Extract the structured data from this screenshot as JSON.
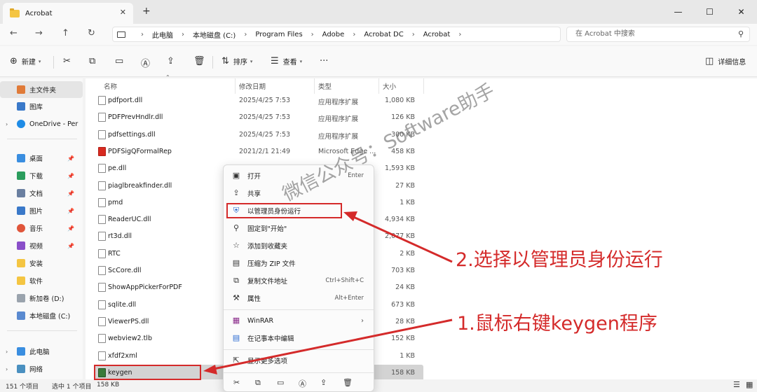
{
  "window": {
    "tab_title": "Acrobat",
    "tab_close": "✕",
    "new_tab": "+",
    "minimize": "—",
    "maximize": "☐",
    "close": "✕"
  },
  "nav": {
    "back": "←",
    "forward": "→",
    "up": "↑",
    "refresh": "↻"
  },
  "breadcrumbs": [
    "此电脑",
    "本地磁盘 (C:)",
    "Program Files",
    "Adobe",
    "Acrobat DC",
    "Acrobat"
  ],
  "search": {
    "placeholder": "在 Acrobat 中搜索"
  },
  "toolbar": {
    "new_label": "新建",
    "sort_label": "排序",
    "view_label": "查看",
    "details_label": "详细信息"
  },
  "sidebar": {
    "home": "主文件夹",
    "gallery": "图库",
    "onedrive": "OneDrive - Per",
    "desktop": "桌面",
    "downloads": "下载",
    "documents": "文档",
    "pictures": "图片",
    "music": "音乐",
    "videos": "视频",
    "install": "安装",
    "software": "软件",
    "new_volume": "新加卷 (D:)",
    "local_disk": "本地磁盘 (C:)",
    "this_pc": "此电脑",
    "network": "网络"
  },
  "columns": {
    "name": "名称",
    "modified": "修改日期",
    "type": "类型",
    "size": "大小"
  },
  "files": [
    {
      "name": "pdfport.dll",
      "date": "2025/4/25 7:53",
      "type": "应用程序扩展",
      "size": "1,080 KB",
      "icon": "dll"
    },
    {
      "name": "PDFPrevHndlr.dll",
      "date": "2025/4/25 7:53",
      "type": "应用程序扩展",
      "size": "126 KB",
      "icon": "dll"
    },
    {
      "name": "pdfsettings.dll",
      "date": "2025/4/25 7:53",
      "type": "应用程序扩展",
      "size": "300 KB",
      "icon": "dll"
    },
    {
      "name": "PDFSigQFormalRep",
      "date": "2021/2/1 21:49",
      "type": "Microsoft Edge ...",
      "size": "458 KB",
      "icon": "pdf"
    },
    {
      "name": "pe.dll",
      "date": "",
      "type": "",
      "size": "1,593 KB",
      "icon": "dll"
    },
    {
      "name": "piaglbreakfinder.dll",
      "date": "",
      "type": "",
      "size": "27 KB",
      "icon": "dll"
    },
    {
      "name": "pmd",
      "date": "",
      "type": "",
      "size": "1 KB",
      "icon": "file"
    },
    {
      "name": "ReaderUC.dll",
      "date": "",
      "type": "",
      "size": "4,934 KB",
      "icon": "dll"
    },
    {
      "name": "rt3d.dll",
      "date": "",
      "type": "",
      "size": "2,077 KB",
      "icon": "dll"
    },
    {
      "name": "RTC",
      "date": "",
      "type": "",
      "size": "2 KB",
      "icon": "file"
    },
    {
      "name": "ScCore.dll",
      "date": "",
      "type": "",
      "size": "703 KB",
      "icon": "dll"
    },
    {
      "name": "ShowAppPickerForPDF",
      "date": "",
      "type": "",
      "size": "24 KB",
      "icon": "dll"
    },
    {
      "name": "sqlite.dll",
      "date": "",
      "type": "",
      "size": "673 KB",
      "icon": "dll"
    },
    {
      "name": "ViewerPS.dll",
      "date": "",
      "type": "",
      "size": "28 KB",
      "icon": "dll"
    },
    {
      "name": "webview2.tlb",
      "date": "",
      "type": "",
      "size": "152 KB",
      "icon": "file"
    },
    {
      "name": "xfdf2xml",
      "date": "",
      "type": "",
      "size": "1 KB",
      "icon": "file"
    },
    {
      "name": "keygen",
      "date": "",
      "type": "",
      "size": "158 KB",
      "icon": "exe"
    }
  ],
  "context_menu": {
    "open": "打开",
    "open_shortcut": "Enter",
    "share": "共享",
    "run_as_admin": "以管理员身份运行",
    "pin_start": "固定到\"开始\"",
    "add_favorites": "添加到收藏夹",
    "compress_zip": "压缩为 ZIP 文件",
    "copy_path": "复制文件地址",
    "copy_path_shortcut": "Ctrl+Shift+C",
    "properties": "属性",
    "properties_shortcut": "Alt+Enter",
    "winrar": "WinRAR",
    "notepad_edit": "在记事本中编辑",
    "more_options": "显示更多选项"
  },
  "status": {
    "count": "151 个项目",
    "selected": "选中 1 个项目",
    "size": "158 KB"
  },
  "annotations": {
    "step2": "2.选择以管理员身份运行",
    "step1": "1.鼠标右键keygen程序",
    "watermark": "微信公众号：Software助手"
  },
  "colors": {
    "accent": "#d42a2a"
  }
}
